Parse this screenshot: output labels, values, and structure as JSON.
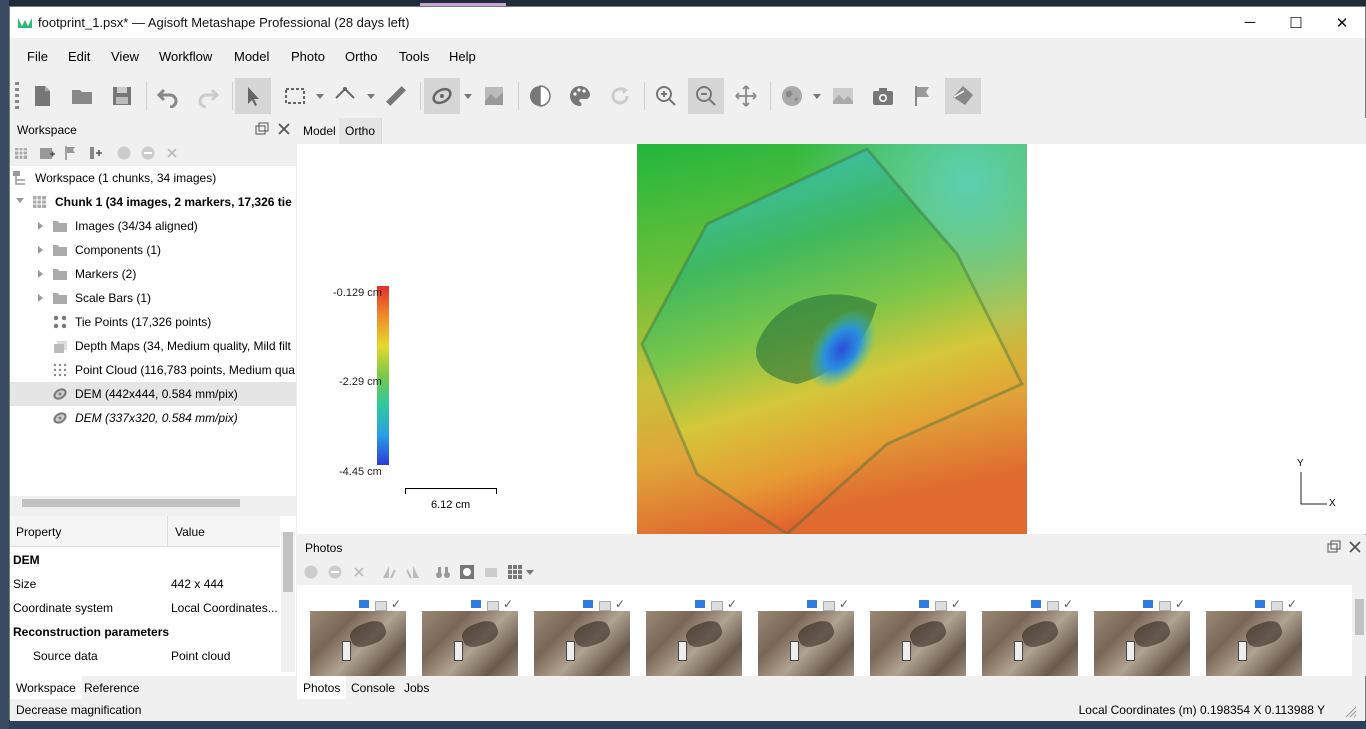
{
  "window": {
    "title": "footprint_1.psx* — Agisoft Metashape Professional (28 days left)",
    "minimize": "─",
    "maximize": "☐",
    "close": "✕"
  },
  "menu": [
    "File",
    "Edit",
    "View",
    "Workflow",
    "Model",
    "Photo",
    "Ortho",
    "Tools",
    "Help"
  ],
  "workspace": {
    "title": "Workspace",
    "items": [
      "Workspace (1 chunks, 34 images)",
      "Chunk 1 (34 images, 2 markers, 17,326 tie p",
      "Images (34/34 aligned)",
      "Components (1)",
      "Markers (2)",
      "Scale Bars (1)",
      "Tie Points (17,326 points)",
      "Depth Maps (34, Medium quality, Mild filt",
      "Point Cloud (116,783 points, Medium qua",
      "DEM (442x444, 0.584 mm/pix)",
      "DEM (337x320, 0.584 mm/pix)"
    ]
  },
  "properties": {
    "col_property": "Property",
    "col_value": "Value",
    "rows": [
      {
        "k": "DEM",
        "v": ""
      },
      {
        "k": "Size",
        "v": "442 x 444"
      },
      {
        "k": "Coordinate system",
        "v": "Local Coordinates..."
      },
      {
        "k": "Reconstruction parameters",
        "v": ""
      },
      {
        "k": "Source data",
        "v": "Point cloud"
      }
    ]
  },
  "left_tabs": [
    "Workspace",
    "Reference"
  ],
  "view_tabs": [
    "Model",
    "Ortho"
  ],
  "legend": {
    "top": "-0.129 cm",
    "mid": "-2.29 cm",
    "bottom": "-4.45 cm"
  },
  "scale_label": "6.12 cm",
  "axis": {
    "y": "Y",
    "x": "X"
  },
  "photos": {
    "title": "Photos",
    "count_visible": 9
  },
  "bottom_tabs": [
    "Photos",
    "Console",
    "Jobs"
  ],
  "status": {
    "left": "Decrease magnification",
    "right": "Local Coordinates (m)   0.198354 X   0.113988 Y"
  },
  "colors": {
    "accent": "#2e7be0",
    "logo": "#2fb87a"
  }
}
